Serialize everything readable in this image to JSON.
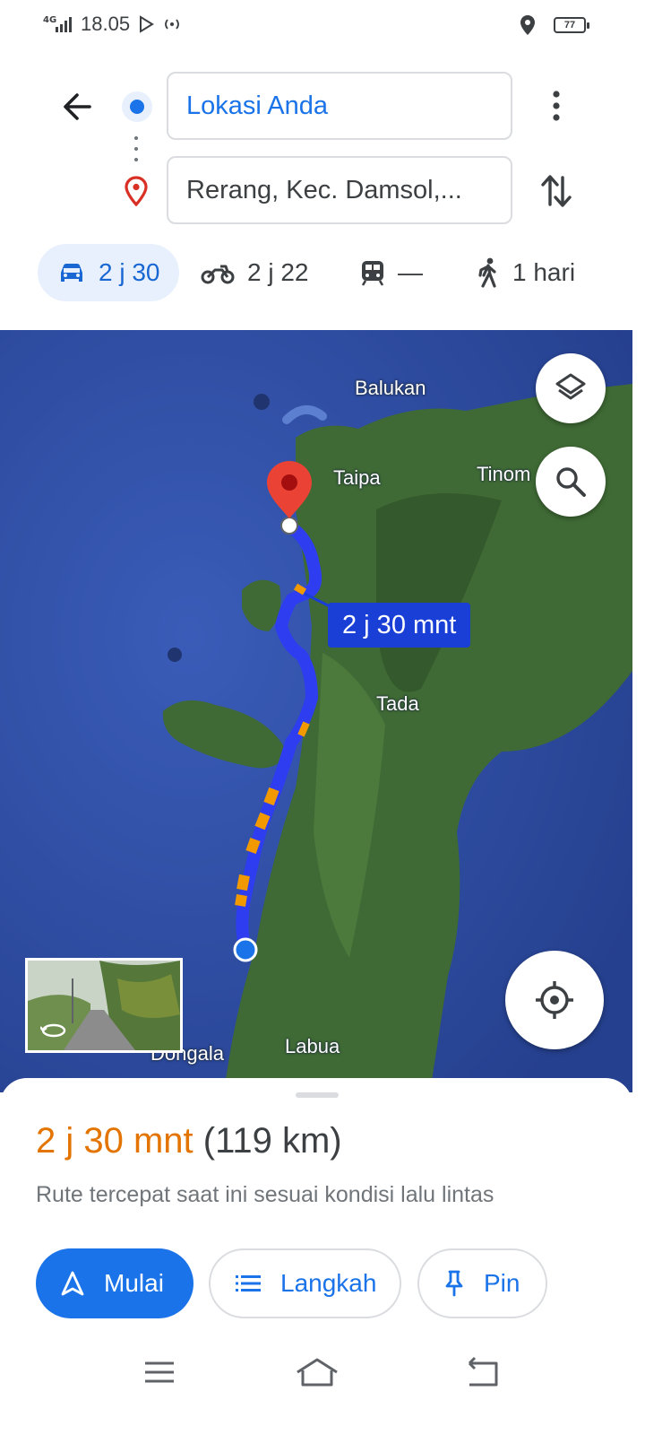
{
  "status_bar": {
    "network": "4G",
    "time": "18.05",
    "battery": "77",
    "icons": [
      "signal-icon",
      "play-store-icon",
      "hotspot-icon",
      "location-icon",
      "battery-icon"
    ]
  },
  "directions": {
    "origin": "Lokasi Anda",
    "destination": "Rerang, Kec. Damsol,...",
    "icons": [
      "back-arrow-icon",
      "origin-dot-icon",
      "destination-pin-icon",
      "more-vert-icon",
      "swap-icon"
    ]
  },
  "modes": [
    {
      "id": "car",
      "icon": "car-icon",
      "label": "2 j 30",
      "selected": true
    },
    {
      "id": "motorcycle",
      "icon": "motorcycle-icon",
      "label": "2 j 22"
    },
    {
      "id": "transit",
      "icon": "train-icon",
      "label": "—"
    },
    {
      "id": "walk",
      "icon": "walk-icon",
      "label": "1 hari"
    }
  ],
  "map": {
    "labels": {
      "balukan": "Balukan",
      "taipa": "Taipa",
      "tinom": "Tinom",
      "tada": "Tada",
      "dongala": "Dongala",
      "labua": "Labua"
    },
    "route_duration": "2 j 30 mnt",
    "colors": {
      "route": "#2e3df0",
      "traffic": "#f29900",
      "water": "#2f4fa8",
      "land": "#3f6a35"
    },
    "icons": [
      "layers-icon",
      "search-icon",
      "my-location-icon",
      "destination-marker-icon",
      "origin-marker-icon",
      "360-icon"
    ]
  },
  "sheet": {
    "duration": "2 j 30 mnt",
    "distance": "(119 km)",
    "description": "Rute tercepat saat ini sesuai kondisi lalu lintas",
    "buttons": {
      "start": "Mulai",
      "steps": "Langkah",
      "pin": "Pin"
    },
    "colors": {
      "duration": "#e37400",
      "primary": "#1a73e8"
    }
  },
  "nav_bar": {
    "icons": [
      "menu-icon",
      "home-icon",
      "back-icon"
    ]
  }
}
